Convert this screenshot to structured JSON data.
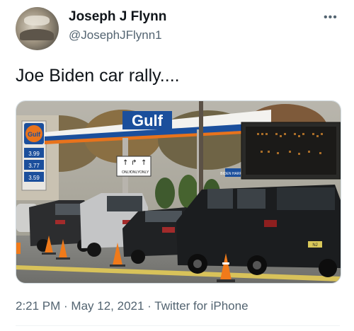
{
  "author": {
    "name": "Joseph J Flynn",
    "handle": "@JosephJFlynn1"
  },
  "tweet": {
    "text": "Joe Biden car rally....",
    "time": "2:21 PM",
    "date": "May 12, 2021",
    "source": "Twitter for iPhone",
    "separator": " · "
  },
  "photo": {
    "station_sign": "Gulf",
    "pylon_brand": "Gulf",
    "price_rows": [
      "3.99",
      "3.77",
      "3.59"
    ],
    "road_sign_words": [
      "ONLY",
      "ONLY",
      "ONLY"
    ],
    "small_signs": [
      "BIDEN HARRIS",
      "BIDEN"
    ],
    "plate": "NJ"
  },
  "icons": {
    "more": "more-horizontal-icon"
  },
  "colors": {
    "gulf_blue": "#1b4f9c",
    "gulf_orange": "#e8731c",
    "secondary_text": "#536471"
  }
}
